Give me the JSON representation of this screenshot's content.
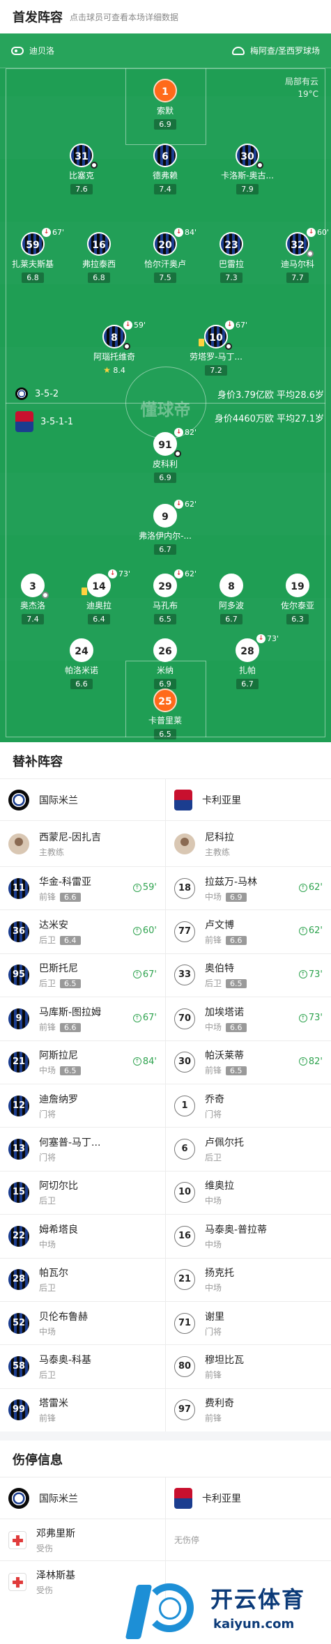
{
  "header": {
    "title": "首发阵容",
    "subtitle": "点击球员可查看本场详细数据"
  },
  "pitch": {
    "referee": "迪贝洛",
    "stadium": "梅阿查/圣西罗球场",
    "weather": "局部有云",
    "temperature": "19°C",
    "watermark": "懂球帝",
    "home_formation": "3-5-2",
    "home_info": "身价3.79亿欧  平均28.6岁",
    "away_formation": "3-5-1-1",
    "away_info": "身价4460万欧  平均27.1岁"
  },
  "home_players": [
    {
      "num": "1",
      "name": "索默",
      "rating": "6.9",
      "gk": true
    },
    {
      "num": "31",
      "name": "比塞克",
      "rating": "7.6",
      "goal": true
    },
    {
      "num": "6",
      "name": "德弗赖",
      "rating": "7.4"
    },
    {
      "num": "30",
      "name": "卡洛斯-奥古...",
      "rating": "7.9",
      "goal": true
    },
    {
      "num": "59",
      "name": "扎莱夫斯基",
      "rating": "6.8",
      "sub": "67'"
    },
    {
      "num": "16",
      "name": "弗拉泰西",
      "rating": "6.8"
    },
    {
      "num": "20",
      "name": "恰尔汗奥卢",
      "rating": "7.5",
      "sub": "84'"
    },
    {
      "num": "23",
      "name": "巴雷拉",
      "rating": "7.3"
    },
    {
      "num": "32",
      "name": "迪马尔科",
      "rating": "7.7",
      "sub": "60'",
      "assist": true
    },
    {
      "num": "8",
      "name": "阿瑙托维奇",
      "rating": "8.4",
      "sub": "59'",
      "goal": true,
      "star": true
    },
    {
      "num": "10",
      "name": "劳塔罗-马丁...",
      "rating": "7.2",
      "sub": "67'",
      "goal": true,
      "card": true
    }
  ],
  "away_players": [
    {
      "num": "91",
      "name": "皮科利",
      "rating": "6.9",
      "sub": "82'",
      "goal": true
    },
    {
      "num": "9",
      "name": "弗洛伊内尔-...",
      "rating": "6.7",
      "sub": "62'"
    },
    {
      "num": "3",
      "name": "奥杰洛",
      "rating": "7.4",
      "assist": true
    },
    {
      "num": "14",
      "name": "迪奥拉",
      "rating": "6.4",
      "sub": "73'",
      "card": true
    },
    {
      "num": "29",
      "name": "马孔布",
      "rating": "6.5",
      "sub": "62'"
    },
    {
      "num": "8",
      "name": "阿多波",
      "rating": "6.7"
    },
    {
      "num": "19",
      "name": "佐尔泰亚",
      "rating": "6.3"
    },
    {
      "num": "24",
      "name": "帕洛米诺",
      "rating": "6.6"
    },
    {
      "num": "26",
      "name": "米纳",
      "rating": "6.9"
    },
    {
      "num": "28",
      "name": "扎帕",
      "rating": "6.7",
      "sub": "73'"
    },
    {
      "num": "25",
      "name": "卡普里莱",
      "rating": "6.5",
      "gk": true
    }
  ],
  "subs": {
    "title": "替补阵容",
    "home_team": "国际米兰",
    "away_team": "卡利亚里",
    "home_coach": {
      "name": "西蒙尼-因扎吉",
      "role": "主教练"
    },
    "away_coach": {
      "name": "尼科拉",
      "role": "主教练"
    },
    "rows": [
      {
        "h": {
          "num": "11",
          "name": "华金-科雷亚",
          "pos": "前锋",
          "rating": "6.6",
          "time": "59'"
        },
        "a": {
          "num": "18",
          "name": "拉兹万-马林",
          "pos": "中场",
          "rating": "6.9",
          "time": "62'"
        }
      },
      {
        "h": {
          "num": "36",
          "name": "达米安",
          "pos": "后卫",
          "rating": "6.4",
          "time": "60'"
        },
        "a": {
          "num": "77",
          "name": "卢文博",
          "pos": "前锋",
          "rating": "6.6",
          "time": "62'"
        }
      },
      {
        "h": {
          "num": "95",
          "name": "巴斯托尼",
          "pos": "后卫",
          "rating": "6.5",
          "time": "67'"
        },
        "a": {
          "num": "33",
          "name": "奥伯特",
          "pos": "后卫",
          "rating": "6.5",
          "time": "73'"
        }
      },
      {
        "h": {
          "num": "9",
          "name": "马库斯-图拉姆",
          "pos": "前锋",
          "rating": "6.6",
          "time": "67'"
        },
        "a": {
          "num": "70",
          "name": "加埃塔诺",
          "pos": "中场",
          "rating": "6.6",
          "time": "73'"
        }
      },
      {
        "h": {
          "num": "21",
          "name": "阿斯拉尼",
          "pos": "中场",
          "rating": "6.5",
          "time": "84'"
        },
        "a": {
          "num": "30",
          "name": "帕沃莱蒂",
          "pos": "前锋",
          "rating": "6.5",
          "time": "82'"
        }
      },
      {
        "h": {
          "num": "12",
          "name": "迪詹纳罗",
          "pos": "门将"
        },
        "a": {
          "num": "1",
          "name": "乔奇",
          "pos": "门将"
        }
      },
      {
        "h": {
          "num": "13",
          "name": "何塞普-马丁...",
          "pos": "门将"
        },
        "a": {
          "num": "6",
          "name": "卢佩尔托",
          "pos": "后卫"
        }
      },
      {
        "h": {
          "num": "15",
          "name": "阿切尔比",
          "pos": "后卫"
        },
        "a": {
          "num": "10",
          "name": "维奥拉",
          "pos": "中场"
        }
      },
      {
        "h": {
          "num": "22",
          "name": "姆希塔良",
          "pos": "中场"
        },
        "a": {
          "num": "16",
          "name": "马泰奥-普拉蒂",
          "pos": "中场"
        }
      },
      {
        "h": {
          "num": "28",
          "name": "帕瓦尔",
          "pos": "后卫"
        },
        "a": {
          "num": "21",
          "name": "扬克托",
          "pos": "中场"
        }
      },
      {
        "h": {
          "num": "52",
          "name": "贝伦布鲁赫",
          "pos": "中场"
        },
        "a": {
          "num": "71",
          "name": "谢里",
          "pos": "门将"
        }
      },
      {
        "h": {
          "num": "58",
          "name": "马泰奥-科基",
          "pos": "后卫"
        },
        "a": {
          "num": "80",
          "name": "穆坦比瓦",
          "pos": "前锋"
        }
      },
      {
        "h": {
          "num": "99",
          "name": "塔雷米",
          "pos": "前锋"
        },
        "a": {
          "num": "97",
          "name": "费利奇",
          "pos": "前锋"
        }
      }
    ]
  },
  "injuries": {
    "title": "伤停信息",
    "home_team": "国际米兰",
    "away_team": "卡利亚里",
    "away_none": "无伤停",
    "home": [
      {
        "name": "邓弗里斯",
        "status": "受伤"
      },
      {
        "name": "泽林斯基",
        "status": "受伤"
      }
    ]
  },
  "brand": {
    "cn": "开云体育",
    "url": "kaiyun.com"
  },
  "colors": {
    "pitch": "#1f9e54",
    "inter_blue": "#1b3d8f",
    "gk_orange": "#ff6a1a",
    "sub_green": "#2fa34f"
  }
}
